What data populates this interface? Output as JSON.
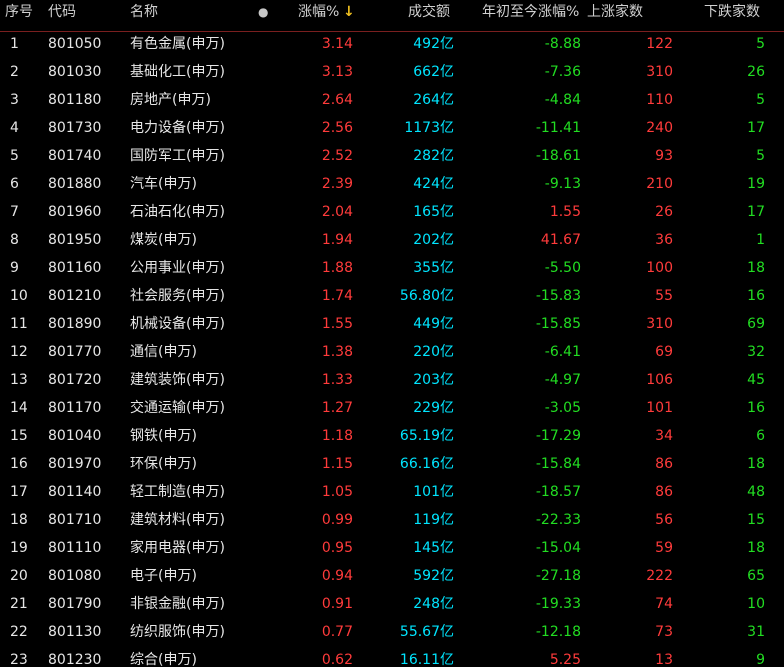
{
  "colors": {
    "up": "#ff3b3b",
    "down": "#22dd22",
    "volume": "#00e5ff",
    "header_line": "#7a1f1f",
    "sort_arrow": "#f0c020"
  },
  "header": {
    "seq": "序号",
    "code": "代码",
    "name": "名称",
    "dot": "●",
    "change": "涨幅%",
    "sort_arrow": "↓",
    "volume": "成交额",
    "ytd": "年初至今涨幅%",
    "up_count": "上涨家数",
    "down_count": "下跌家数"
  },
  "rows": [
    {
      "seq": "1",
      "code": "801050",
      "name": "有色金属(申万)",
      "change": "3.14",
      "volume": "492亿",
      "ytd": "-8.88",
      "up": "122",
      "down": "5"
    },
    {
      "seq": "2",
      "code": "801030",
      "name": "基础化工(申万)",
      "change": "3.13",
      "volume": "662亿",
      "ytd": "-7.36",
      "up": "310",
      "down": "26"
    },
    {
      "seq": "3",
      "code": "801180",
      "name": "房地产(申万)",
      "change": "2.64",
      "volume": "264亿",
      "ytd": "-4.84",
      "up": "110",
      "down": "5"
    },
    {
      "seq": "4",
      "code": "801730",
      "name": "电力设备(申万)",
      "change": "2.56",
      "volume": "1173亿",
      "ytd": "-11.41",
      "up": "240",
      "down": "17"
    },
    {
      "seq": "5",
      "code": "801740",
      "name": "国防军工(申万)",
      "change": "2.52",
      "volume": "282亿",
      "ytd": "-18.61",
      "up": "93",
      "down": "5"
    },
    {
      "seq": "6",
      "code": "801880",
      "name": "汽车(申万)",
      "change": "2.39",
      "volume": "424亿",
      "ytd": "-9.13",
      "up": "210",
      "down": "19"
    },
    {
      "seq": "7",
      "code": "801960",
      "name": "石油石化(申万)",
      "change": "2.04",
      "volume": "165亿",
      "ytd": "1.55",
      "up": "26",
      "down": "17"
    },
    {
      "seq": "8",
      "code": "801950",
      "name": "煤炭(申万)",
      "change": "1.94",
      "volume": "202亿",
      "ytd": "41.67",
      "up": "36",
      "down": "1"
    },
    {
      "seq": "9",
      "code": "801160",
      "name": "公用事业(申万)",
      "change": "1.88",
      "volume": "355亿",
      "ytd": "-5.50",
      "up": "100",
      "down": "18"
    },
    {
      "seq": "10",
      "code": "801210",
      "name": "社会服务(申万)",
      "change": "1.74",
      "volume": "56.80亿",
      "ytd": "-15.83",
      "up": "55",
      "down": "16"
    },
    {
      "seq": "11",
      "code": "801890",
      "name": "机械设备(申万)",
      "change": "1.55",
      "volume": "449亿",
      "ytd": "-15.85",
      "up": "310",
      "down": "69"
    },
    {
      "seq": "12",
      "code": "801770",
      "name": "通信(申万)",
      "change": "1.38",
      "volume": "220亿",
      "ytd": "-6.41",
      "up": "69",
      "down": "32"
    },
    {
      "seq": "13",
      "code": "801720",
      "name": "建筑装饰(申万)",
      "change": "1.33",
      "volume": "203亿",
      "ytd": "-4.97",
      "up": "106",
      "down": "45"
    },
    {
      "seq": "14",
      "code": "801170",
      "name": "交通运输(申万)",
      "change": "1.27",
      "volume": "229亿",
      "ytd": "-3.05",
      "up": "101",
      "down": "16"
    },
    {
      "seq": "15",
      "code": "801040",
      "name": "钢铁(申万)",
      "change": "1.18",
      "volume": "65.19亿",
      "ytd": "-17.29",
      "up": "34",
      "down": "6"
    },
    {
      "seq": "16",
      "code": "801970",
      "name": "环保(申万)",
      "change": "1.15",
      "volume": "66.16亿",
      "ytd": "-15.84",
      "up": "86",
      "down": "18"
    },
    {
      "seq": "17",
      "code": "801140",
      "name": "轻工制造(申万)",
      "change": "1.05",
      "volume": "101亿",
      "ytd": "-18.57",
      "up": "86",
      "down": "48"
    },
    {
      "seq": "18",
      "code": "801710",
      "name": "建筑材料(申万)",
      "change": "0.99",
      "volume": "119亿",
      "ytd": "-22.33",
      "up": "56",
      "down": "15"
    },
    {
      "seq": "19",
      "code": "801110",
      "name": "家用电器(申万)",
      "change": "0.95",
      "volume": "145亿",
      "ytd": "-15.04",
      "up": "59",
      "down": "18"
    },
    {
      "seq": "20",
      "code": "801080",
      "name": "电子(申万)",
      "change": "0.94",
      "volume": "592亿",
      "ytd": "-27.18",
      "up": "222",
      "down": "65"
    },
    {
      "seq": "21",
      "code": "801790",
      "name": "非银金融(申万)",
      "change": "0.91",
      "volume": "248亿",
      "ytd": "-19.33",
      "up": "74",
      "down": "10"
    },
    {
      "seq": "22",
      "code": "801130",
      "name": "纺织服饰(申万)",
      "change": "0.77",
      "volume": "55.67亿",
      "ytd": "-12.18",
      "up": "73",
      "down": "31"
    },
    {
      "seq": "23",
      "code": "801230",
      "name": "综合(申万)",
      "change": "0.62",
      "volume": "16.11亿",
      "ytd": "5.25",
      "up": "13",
      "down": "9"
    }
  ]
}
